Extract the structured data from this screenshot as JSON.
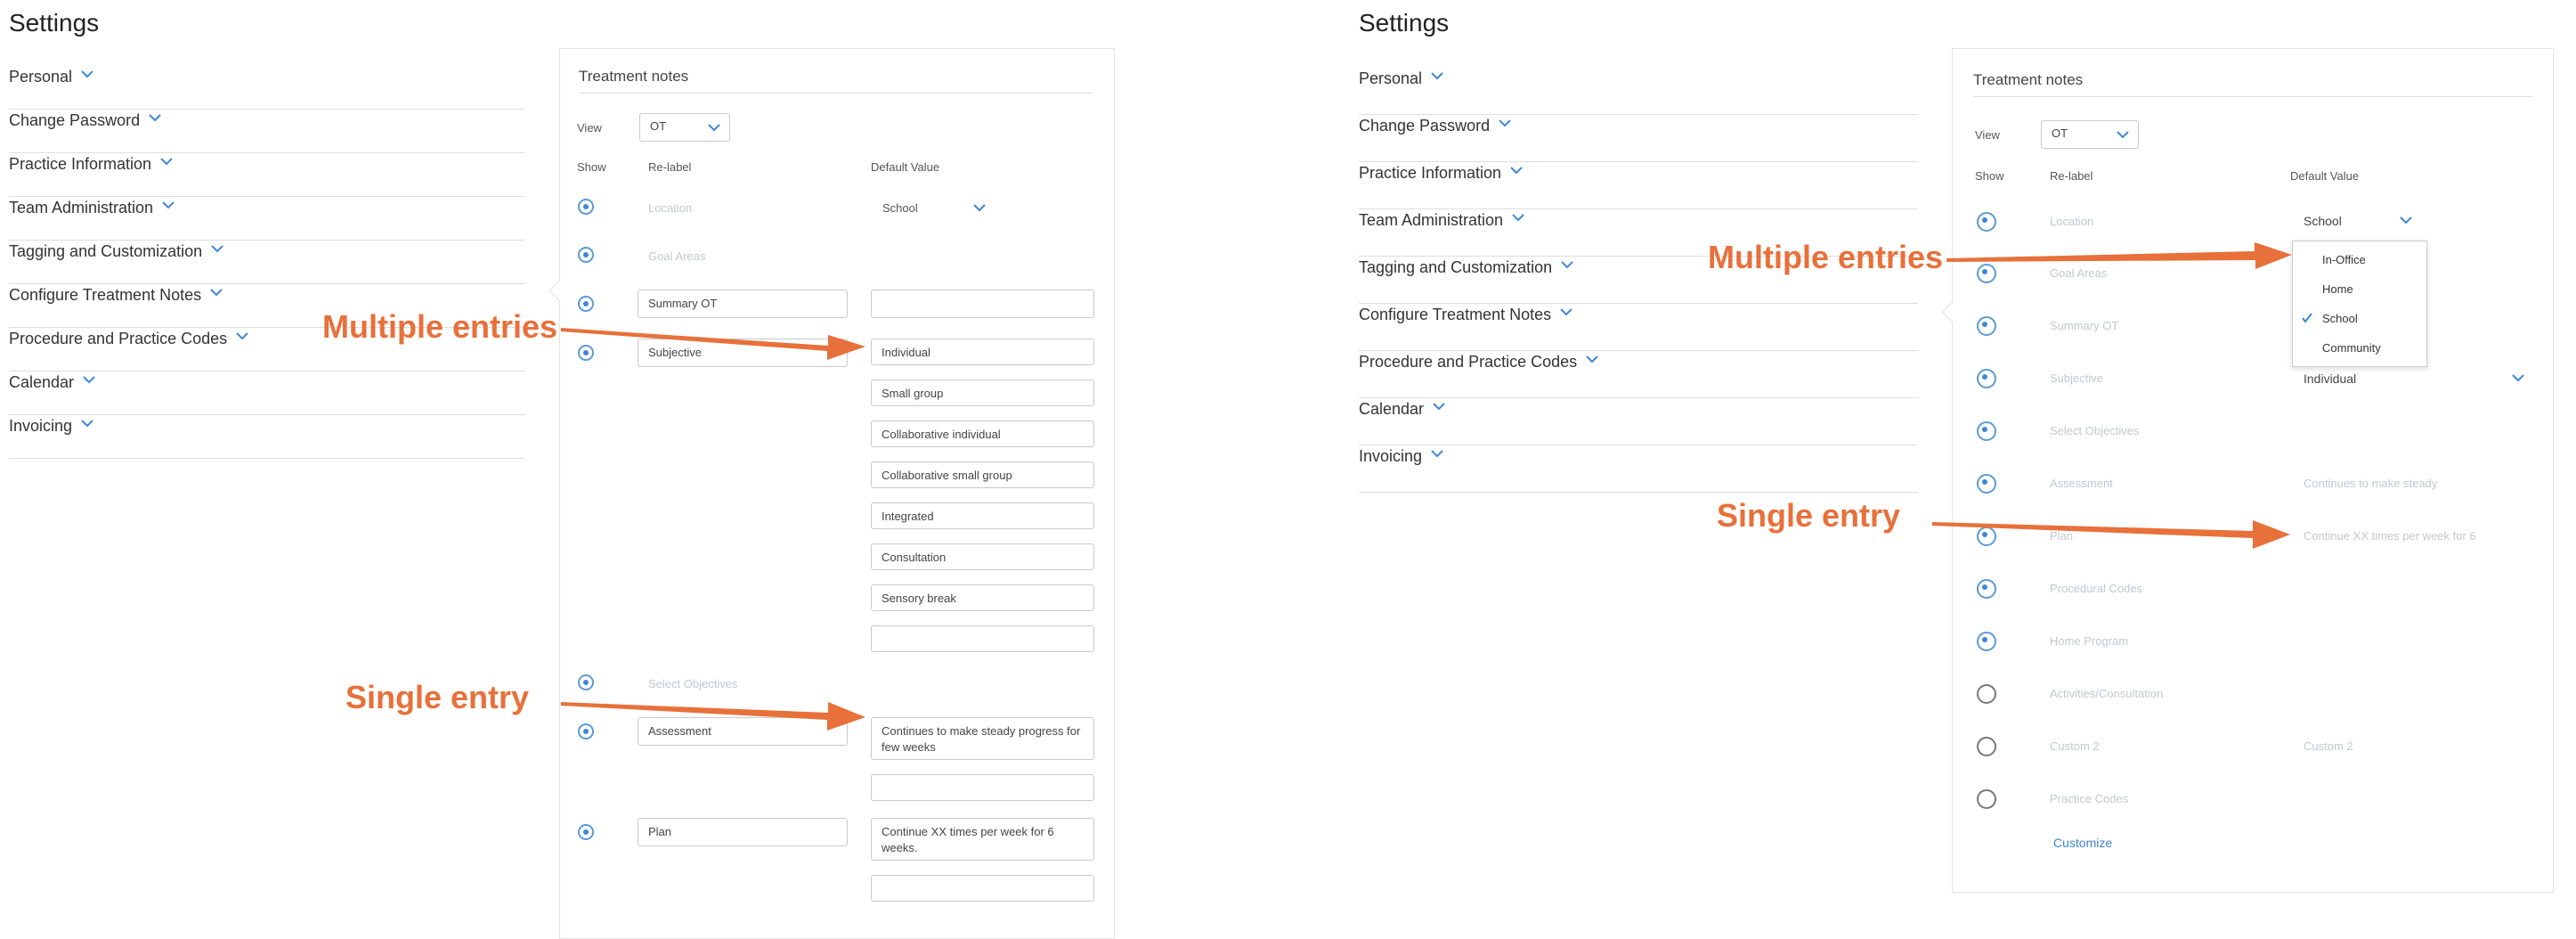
{
  "left": {
    "title": "Settings",
    "menu": [
      "Personal",
      "Change Password",
      "Practice Information",
      "Team Administration",
      "Tagging and Customization",
      "Configure Treatment Notes",
      "Procedure and Practice Codes",
      "Calendar",
      "Invoicing"
    ],
    "panel": {
      "title": "Treatment notes",
      "view_label": "View",
      "view_value": "OT",
      "col_show": "Show",
      "col_relabel": "Re-label",
      "col_default": "Default Value",
      "location_label": "Location",
      "location_value": "School",
      "goal_areas_label": "Goal Areas",
      "summary_value": "Summary OT",
      "subjective_value": "Subjective",
      "subjective_defaults": [
        "Individual",
        "Small group",
        "Collaborative individual",
        "Collaborative small group",
        "Integrated",
        "Consultation",
        "Sensory break"
      ],
      "select_objectives_label": "Select Objectives",
      "assessment_value": "Assessment",
      "assessment_default": "Continues to make steady progress for few weeks",
      "plan_value": "Plan",
      "plan_default": "Continue XX times per week for 6 weeks."
    },
    "annotations": {
      "multiple": "Multiple entries",
      "single": "Single entry"
    }
  },
  "right": {
    "title": "Settings",
    "menu": [
      "Personal",
      "Change Password",
      "Practice Information",
      "Team Administration",
      "Tagging and Customization",
      "Configure Treatment Notes",
      "Procedure and Practice Codes",
      "Calendar",
      "Invoicing"
    ],
    "panel": {
      "title": "Treatment notes",
      "view_label": "View",
      "view_value": "OT",
      "col_show": "Show",
      "col_relabel": "Re-label",
      "col_default": "Default Value",
      "fields": [
        "Location",
        "Goal Areas",
        "Summary OT",
        "Subjective",
        "Select Objectives",
        "Assessment",
        "Plan",
        "Procedural Codes",
        "Home Program",
        "Activities/Consultation",
        "Custom 2",
        "Practice Codes"
      ],
      "location_value": "School",
      "location_options": [
        "In-Office",
        "Home",
        "School",
        "Community"
      ],
      "subjective_value": "Individual",
      "assessment_default": "Continues to make steady",
      "plan_default": "Continue XX times per week for 6",
      "custom2_default": "Custom 2",
      "customize_link": "Customize"
    },
    "annotations": {
      "multiple": "Multiple entries",
      "single": "Single entry"
    }
  },
  "colors": {
    "accent": "#3d86d8",
    "annotation": "#e8703a",
    "border": "#c9c9c9",
    "faded": "#c4c7cc"
  }
}
